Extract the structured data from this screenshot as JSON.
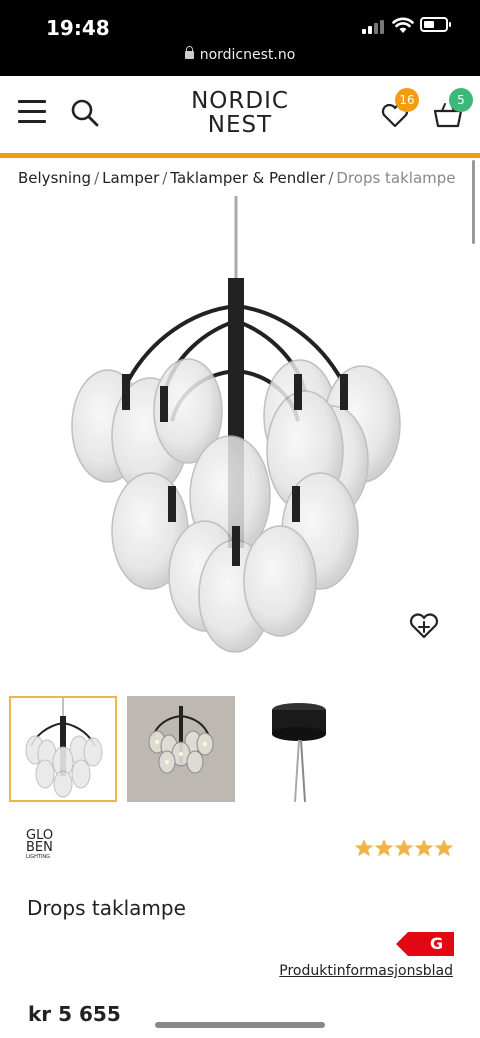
{
  "status_bar": {
    "time": "19:48",
    "url": "nordicnest.no"
  },
  "header": {
    "logo_line1": "NORDIC",
    "logo_line2": "NEST",
    "wishlist_count": "16",
    "cart_count": "5",
    "colors": {
      "accent": "#f39c12",
      "cart_badge": "#3cb878"
    }
  },
  "breadcrumb": {
    "items": [
      "Belysning",
      "Lamper",
      "Taklamper & Pendler"
    ],
    "current": "Drops taklampe",
    "separator": "/"
  },
  "gallery": {
    "thumbnails": [
      "thumbnail-chandelier-white",
      "thumbnail-chandelier-gray",
      "thumbnail-ceiling-canopy"
    ],
    "selected_index": 0,
    "favorite_icon": "heart-plus-icon"
  },
  "product": {
    "brand_line1": "GLO",
    "brand_line2": "BEN",
    "brand_tag": "LIGHTING",
    "rating": 5,
    "rating_max": 5,
    "title": "Drops taklampe",
    "energy_class": "G",
    "datasheet_link": "Produktinformasjonsblad",
    "price": "kr 5 655"
  }
}
